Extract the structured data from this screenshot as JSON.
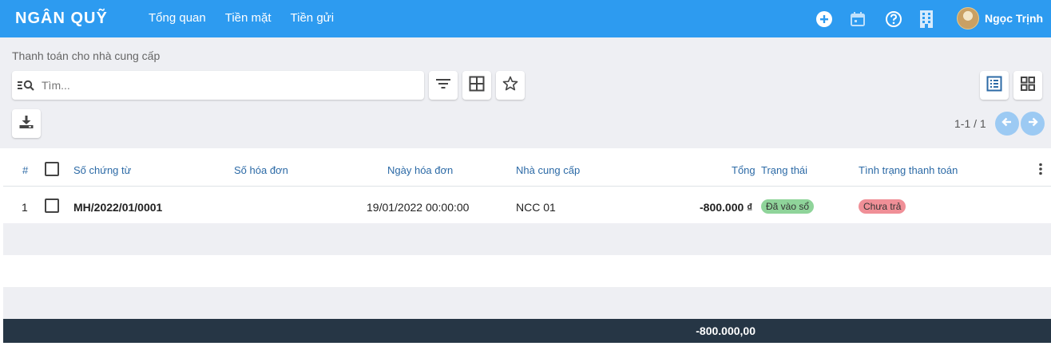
{
  "app": {
    "brand": "NGÂN QUỸ"
  },
  "menu": [
    "Tổng quan",
    "Tiền mặt",
    "Tiền gửi"
  ],
  "topbar_icons": [
    "plus-circle-icon",
    "calendar-icon",
    "help-icon",
    "building-icon"
  ],
  "user": {
    "name": "Ngọc Trịnh"
  },
  "breadcrumb": "Thanh toán cho nhà cung cấp",
  "search": {
    "placeholder": "Tìm..."
  },
  "pager": "1-1 / 1",
  "table": {
    "headers": {
      "num": "#",
      "voucher": "Số chứng từ",
      "invoice_no": "Số hóa đơn",
      "invoice_date": "Ngày hóa đơn",
      "supplier": "Nhà cung cấp",
      "total": "Tổng",
      "status": "Trạng thái",
      "payment": "Tình trạng thanh toán"
    },
    "rows": [
      {
        "num": "1",
        "voucher": "MH/2022/01/0001",
        "invoice_no": "",
        "invoice_date": "19/01/2022 00:00:00",
        "supplier": "NCC 01",
        "total": "-800.000 ₫",
        "status": "Đã vào sổ",
        "payment": "Chưa trả"
      }
    ],
    "footer_total": "-800.000,00"
  },
  "colors": {
    "topbar": "#2d9bf0",
    "status_badge": "#8fd49a",
    "payment_badge": "#f08f97",
    "footer": "#263645"
  }
}
